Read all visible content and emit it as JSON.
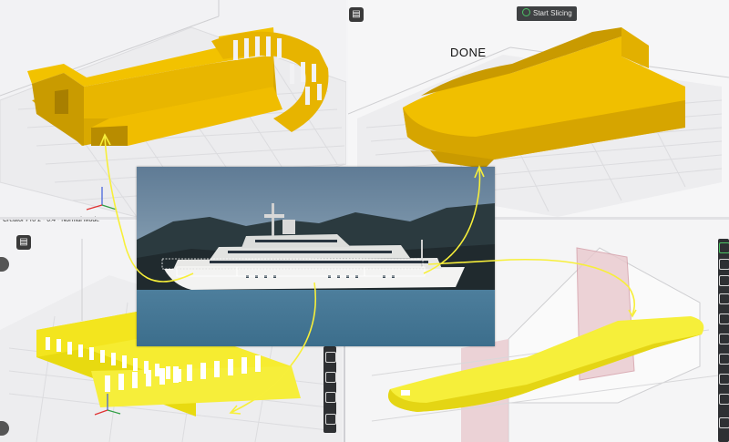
{
  "toolbar": {
    "slice_button": "Start Slicing",
    "status_text": "DONE",
    "printer_mode": "Creator Pro 2 - 0.4 - Normal Mode"
  },
  "icons": {
    "file": "file-icon",
    "slice": "play-circle-icon",
    "side_tools": [
      "move-icon",
      "rotate-icon",
      "scale-icon",
      "mirror-icon",
      "cut-icon",
      "support-icon",
      "settings-icon",
      "link-icon"
    ]
  },
  "colors": {
    "model_yellow": "#e9b800",
    "model_light_yellow": "#f4ef3c",
    "annotation_line": "#f7ef3a",
    "accent_green": "#4cc265",
    "toolbar_dark": "#2e3033"
  }
}
